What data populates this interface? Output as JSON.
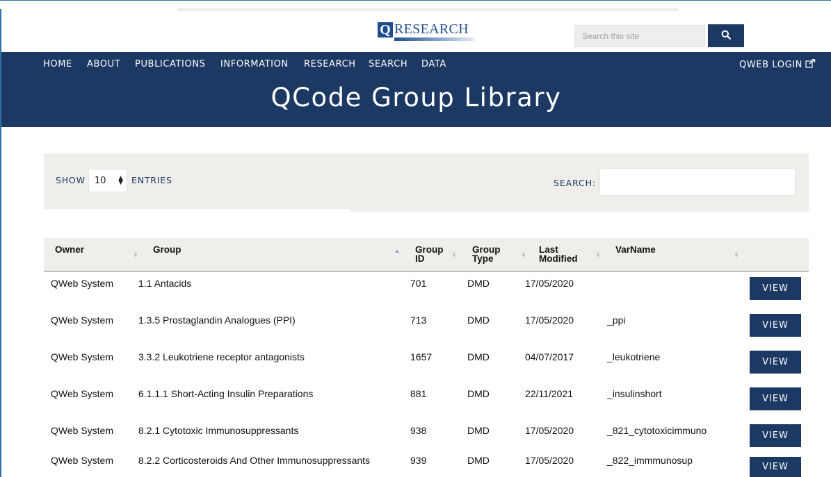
{
  "header": {
    "logo_letter": "Q",
    "logo_text": "RESEARCH",
    "search_placeholder": "Search this site",
    "search_icon": "search-icon"
  },
  "nav": {
    "items": [
      "HOME",
      "ABOUT",
      "PUBLICATIONS",
      "INFORMATION",
      "RESEARCH",
      "SEARCH",
      "DATA"
    ],
    "external_link": "QWEB LOGIN",
    "external_icon": "external-link-icon"
  },
  "page": {
    "title": "QCode Group Library"
  },
  "filter": {
    "show_label": "SHOW",
    "entries_value": "10",
    "entries_label": "ENTRIES",
    "search_label": "SEARCH:",
    "search_value": ""
  },
  "table": {
    "columns": [
      {
        "label_line1": "Owner",
        "label_line2": ""
      },
      {
        "label_line1": "Group",
        "label_line2": ""
      },
      {
        "label_line1": "Group",
        "label_line2": "ID"
      },
      {
        "label_line1": "Group",
        "label_line2": "Type"
      },
      {
        "label_line1": "Last",
        "label_line2": "Modified"
      },
      {
        "label_line1": "VarName",
        "label_line2": ""
      }
    ],
    "rows": [
      {
        "owner": "QWeb System",
        "group": "1.1 Antacids",
        "group_id": "701",
        "group_type": "DMD",
        "last_modified": "17/05/2020",
        "varname": "",
        "action": "VIEW"
      },
      {
        "owner": "QWeb System",
        "group": "1.3.5 Prostaglandin Analogues (PPI)",
        "group_id": "713",
        "group_type": "DMD",
        "last_modified": "17/05/2020",
        "varname": "_ppi",
        "action": "VIEW"
      },
      {
        "owner": "QWeb System",
        "group": "3.3.2 Leukotriene receptor antagonists",
        "group_id": "1657",
        "group_type": "DMD",
        "last_modified": "04/07/2017",
        "varname": "_leukotriene",
        "action": "VIEW"
      },
      {
        "owner": "QWeb System",
        "group": "6.1.1.1 Short-Acting Insulin Preparations",
        "group_id": "881",
        "group_type": "DMD",
        "last_modified": "22/11/2021",
        "varname": "_insulinshort",
        "action": "VIEW"
      },
      {
        "owner": "QWeb System",
        "group": "8.2.1 Cytotoxic Immunosuppressants",
        "group_id": "938",
        "group_type": "DMD",
        "last_modified": "17/05/2020",
        "varname": "_821_cytotoxicimmuno",
        "action": "VIEW"
      },
      {
        "owner": "QWeb System",
        "group": "8.2.2 Corticosteroids And Other Immunosuppressants",
        "group_id": "939",
        "group_type": "DMD",
        "last_modified": "17/05/2020",
        "varname": "_822_immmunosup",
        "action": "VIEW"
      }
    ]
  },
  "colors": {
    "navy": "#1b3963",
    "panel": "#f0eeeb",
    "sort_active": "#8a8fd6"
  }
}
